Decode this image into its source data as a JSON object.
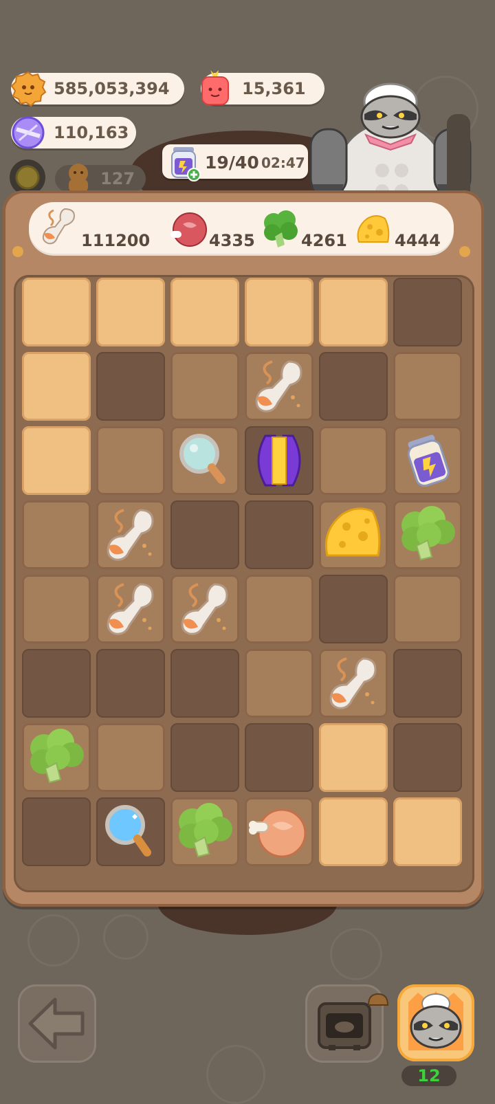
{
  "currencies": {
    "cookies": "585,053,394",
    "gems": "15,361",
    "crystals": "110,163",
    "energy": "19/40",
    "energy_timer": "02:47",
    "buddies": "127"
  },
  "resources": {
    "sauce": "111200",
    "meat": "4335",
    "broccoli": "4261",
    "cheese": "4444"
  },
  "board": {
    "cells": [
      [
        "light",
        "light",
        "light",
        "light",
        "light",
        "dark"
      ],
      [
        "light",
        "dark",
        "mid",
        "mid",
        "dark",
        "mid"
      ],
      [
        "light",
        "mid",
        "mid",
        "dark",
        "mid",
        "mid"
      ],
      [
        "mid",
        "mid",
        "dark",
        "dark",
        "mid",
        "mid"
      ],
      [
        "mid",
        "mid",
        "mid",
        "mid",
        "dark",
        "mid"
      ],
      [
        "dark",
        "dark",
        "dark",
        "mid",
        "mid",
        "dark"
      ],
      [
        "mid",
        "mid",
        "dark",
        "dark",
        "light",
        "dark"
      ],
      [
        "dark",
        "dark",
        "mid",
        "mid",
        "light",
        "light"
      ]
    ],
    "items": [
      {
        "row": 1,
        "col": 3,
        "item": "sauce-spoon"
      },
      {
        "row": 2,
        "col": 2,
        "item": "magnifier"
      },
      {
        "row": 2,
        "col": 3,
        "item": "portal-gem"
      },
      {
        "row": 2,
        "col": 5,
        "item": "energy-jar"
      },
      {
        "row": 3,
        "col": 1,
        "item": "sauce-spoon"
      },
      {
        "row": 3,
        "col": 4,
        "item": "cheese"
      },
      {
        "row": 3,
        "col": 5,
        "item": "broccoli"
      },
      {
        "row": 4,
        "col": 1,
        "item": "sauce-spoon"
      },
      {
        "row": 4,
        "col": 2,
        "item": "sauce-spoon"
      },
      {
        "row": 5,
        "col": 4,
        "item": "sauce-spoon"
      },
      {
        "row": 6,
        "col": 0,
        "item": "broccoli"
      },
      {
        "row": 7,
        "col": 1,
        "item": "magnifier-blue"
      },
      {
        "row": 7,
        "col": 2,
        "item": "broccoli"
      },
      {
        "row": 7,
        "col": 3,
        "item": "meat"
      }
    ]
  },
  "chef": {
    "level": "12"
  },
  "colors": {
    "background": "#6e655b",
    "light_tile": "#f0c082",
    "mid_tile": "#a57e5c",
    "dark_tile": "#735644",
    "level_text": "#3dd13d"
  }
}
